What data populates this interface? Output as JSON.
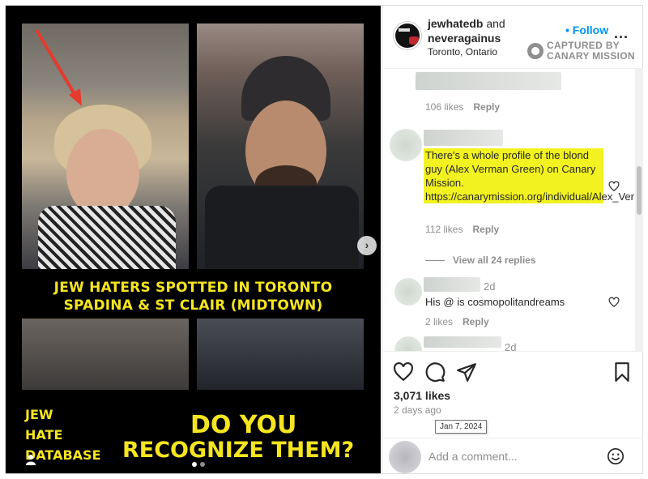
{
  "post": {
    "headline_line1": "JEW HATERS SPOTTED IN TORONTO",
    "headline_line2": "SPADINA & ST CLAIR (MIDTOWN)",
    "question_line1": "DO YOU",
    "question_line2": "RECOGNIZE THEM?",
    "brand_line1": "JEW",
    "brand_line2": "HATE",
    "brand_line3": "DATABASE",
    "next_glyph": "›",
    "carousel_total": 2,
    "carousel_active": 1
  },
  "header": {
    "author1": "jewhatedb",
    "and": " and",
    "author2": "neveragainus",
    "location": "Toronto, Ontario",
    "follow_label": "• Follow",
    "more_label": "...",
    "watermark_line1": "CAPTURED BY",
    "watermark_line2": "CANARY MISSION"
  },
  "comments": {
    "c0_likes": "106 likes",
    "reply_label": "Reply",
    "c1_text": "There's a whole profile of the blond guy (Alex Verman Green) on Canary Mission. https://canarymission.org/individual/Alex_Verman_Green",
    "c1_likes": "112 likes",
    "view_replies": "View all 24 replies",
    "c2_time": "2d",
    "c2_text": "His @ is cosmopolitandreams",
    "c2_likes": "2 likes",
    "c3_time": "2d"
  },
  "actions": {
    "likes": "3,071 likes",
    "ago": "2 days ago",
    "tooltip": "Jan 7, 2024",
    "comment_placeholder": "Add a comment..."
  },
  "colors": {
    "accent": "#0095f6",
    "highlight": "#f2f220",
    "post_yellow": "#f5e51f"
  },
  "icons": [
    "heart-icon",
    "comment-icon",
    "share-icon",
    "bookmark-icon",
    "emoji-icon",
    "more-icon",
    "user-tag-icon",
    "chevron-right-icon"
  ]
}
